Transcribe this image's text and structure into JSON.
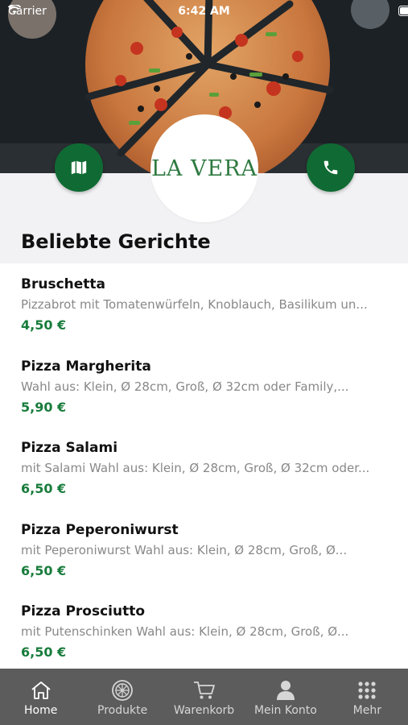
{
  "status_bar": {
    "carrier": "Carrier",
    "time": "6:42 AM"
  },
  "brand": {
    "logo_text": "LA VERA"
  },
  "section": {
    "title": "Beliebte Gerichte"
  },
  "dishes": [
    {
      "name": "Bruschetta",
      "description": "Pizzabrot mit Tomatenwürfeln, Knoblauch, Basilikum un...",
      "price": "4,50 €"
    },
    {
      "name": "Pizza Margherita",
      "description": "Wahl aus: Klein, Ø 28cm, Groß, Ø 32cm oder Family,...",
      "price": "5,90 €"
    },
    {
      "name": "Pizza Salami",
      "description": "mit Salami Wahl aus: Klein, Ø 28cm, Groß, Ø 32cm oder...",
      "price": "6,50 €"
    },
    {
      "name": "Pizza Peperoniwurst",
      "description": "mit Peperoniwurst Wahl aus: Klein, Ø 28cm, Groß, Ø...",
      "price": "6,50 €"
    },
    {
      "name": "Pizza Prosciutto",
      "description": "mit Putenschinken Wahl aus: Klein, Ø 28cm, Groß, Ø...",
      "price": "6,50 €"
    }
  ],
  "tabbar": {
    "items": [
      {
        "label": "Home",
        "icon": "home-icon",
        "active": true
      },
      {
        "label": "Produkte",
        "icon": "pizza-icon",
        "active": false
      },
      {
        "label": "Warenkorb",
        "icon": "cart-icon",
        "active": false
      },
      {
        "label": "Mein Konto",
        "icon": "person-icon",
        "active": false
      },
      {
        "label": "Mehr",
        "icon": "grid-icon",
        "active": false
      }
    ]
  },
  "colors": {
    "accent": "#0f6b33",
    "price": "#187c3c",
    "tabbar": "#5c5c5c"
  }
}
